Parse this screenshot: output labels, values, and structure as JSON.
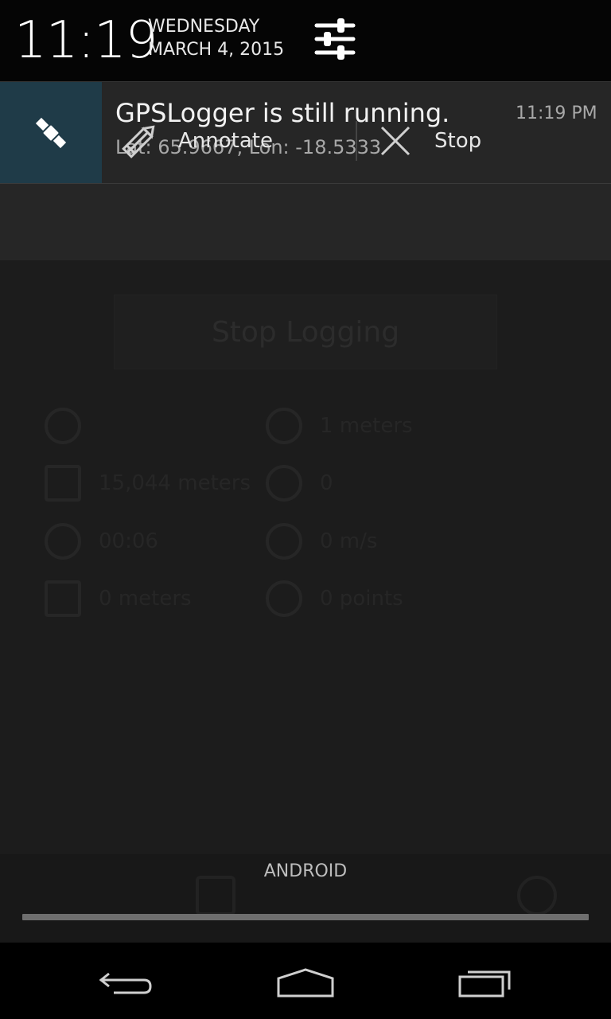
{
  "status": {
    "time": "11:19",
    "day": "WEDNESDAY",
    "date": "MARCH 4, 2015",
    "settings_icon": "sliders-icon"
  },
  "notification": {
    "app_icon": "satellite-icon",
    "title": "GPSLogger is still running.",
    "text": "Lat: 65.9667, Lon: -18.5333",
    "time": "11:19 PM",
    "icon_bg_color": "#1f3b48",
    "actions": [
      {
        "label": "Annotate",
        "icon": "pencil-icon"
      },
      {
        "label": "Stop",
        "icon": "close-icon"
      }
    ]
  },
  "background_app": {
    "button": "Stop Logging",
    "rows": [
      [
        "",
        "1 meters"
      ],
      [
        "15,044 meters",
        "0"
      ],
      [
        "00:06",
        "0 m/s"
      ],
      [
        "0  meters",
        "0 points"
      ]
    ]
  },
  "android_label": "ANDROID",
  "navbar": {
    "back": "back-icon",
    "home": "home-icon",
    "recents": "recents-icon"
  }
}
